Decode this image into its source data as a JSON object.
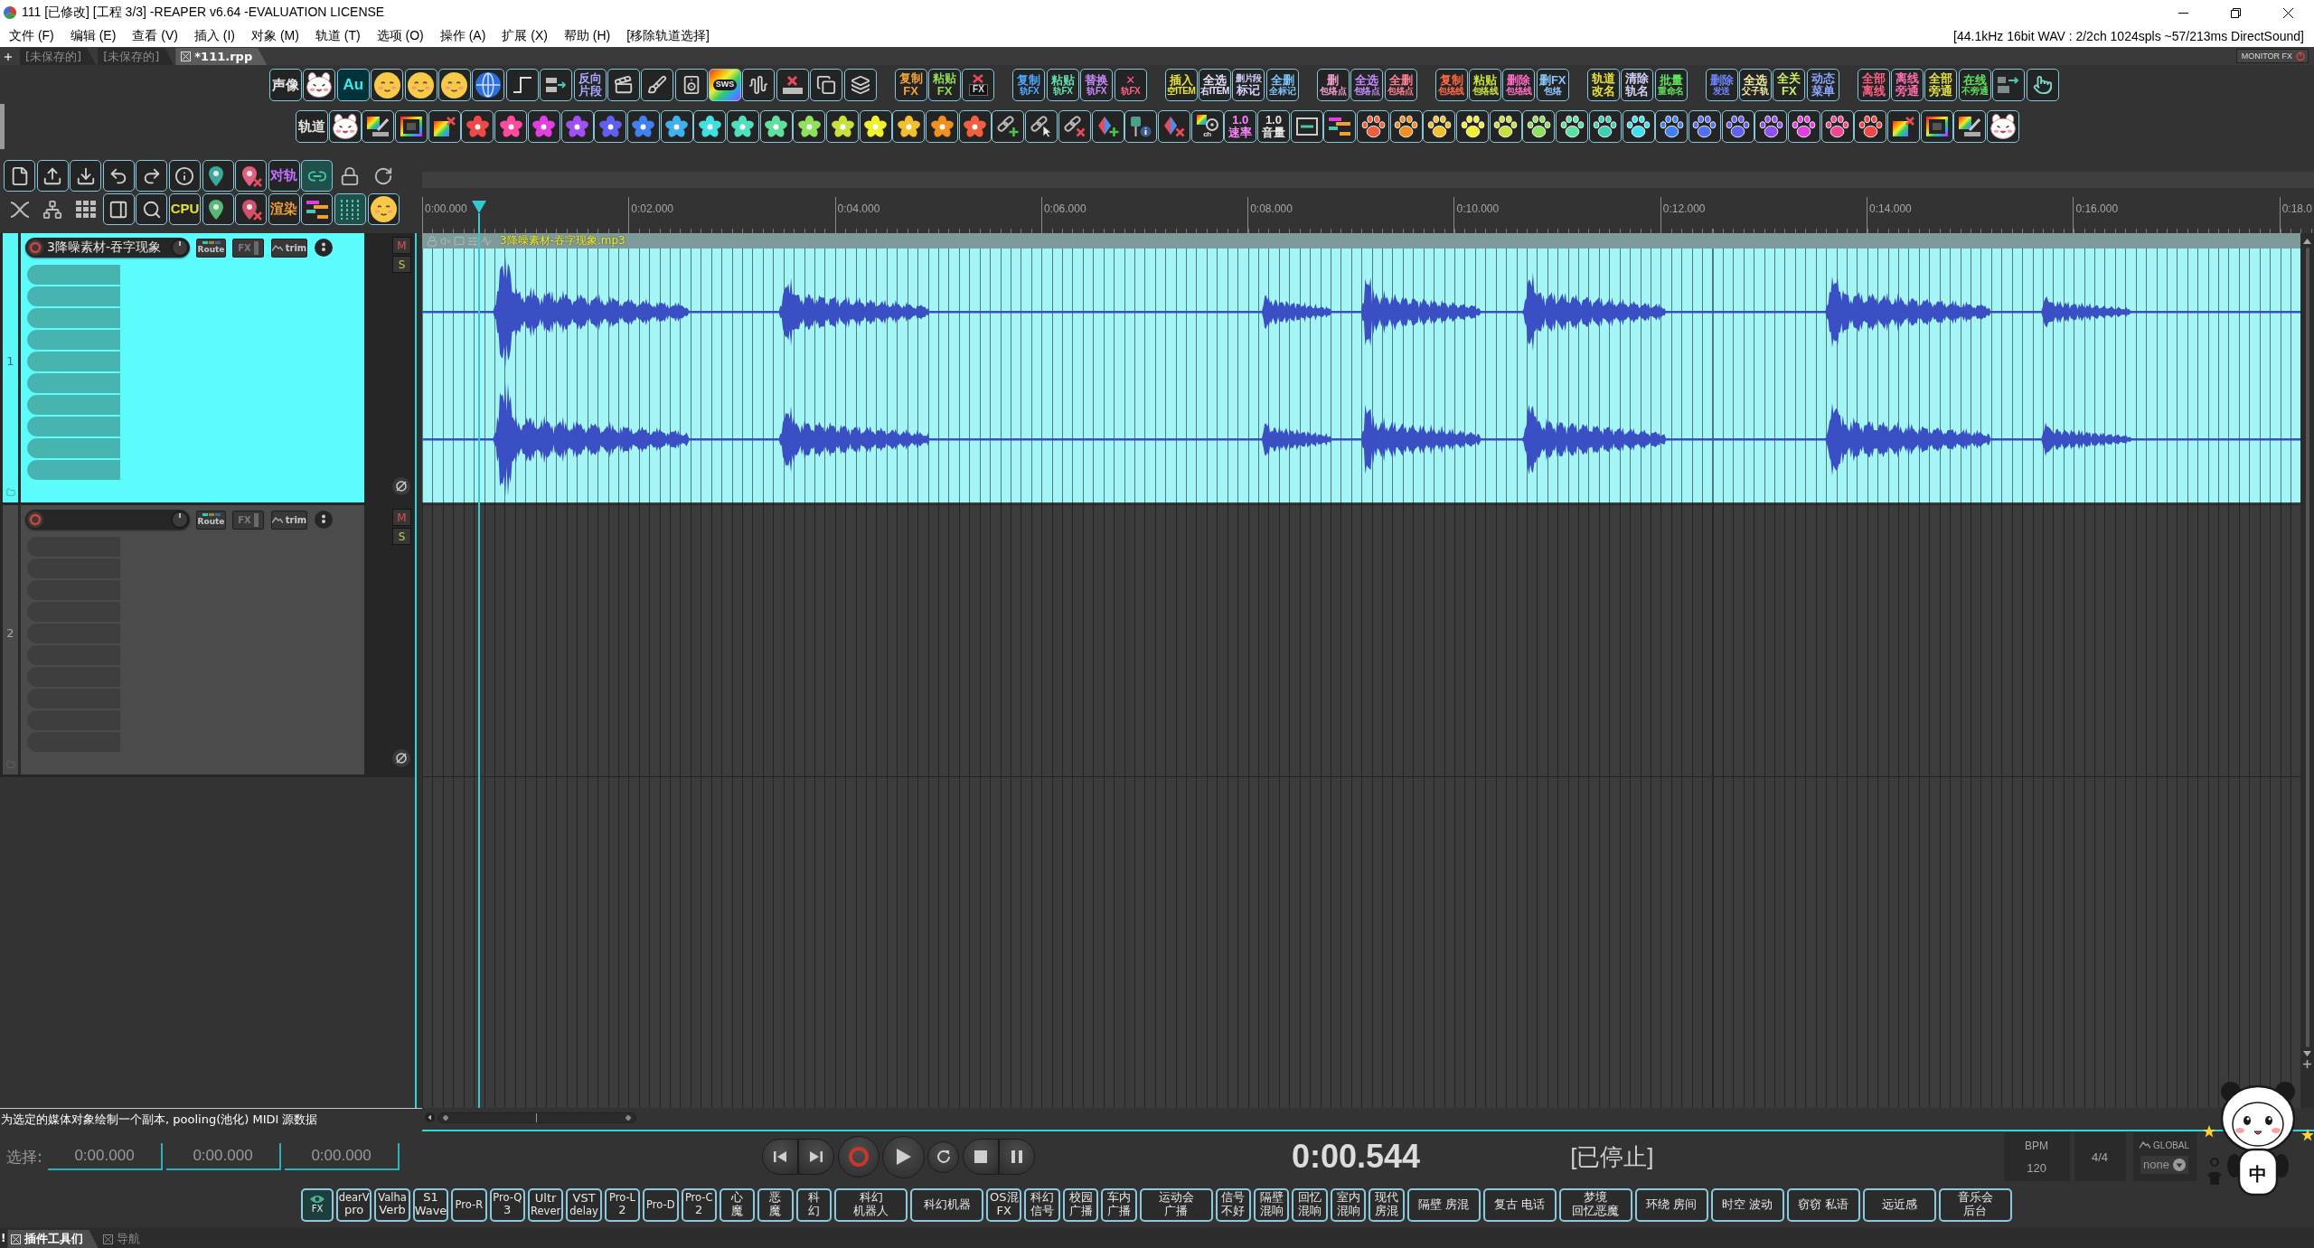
{
  "window": {
    "title": "111 [已修改] [工程 3/3] -REAPER v6.64 -EVALUATION LICENSE"
  },
  "menu": [
    "文件 (F)",
    "编辑 (E)",
    "查看 (V)",
    "插入 (I)",
    "对象 (M)",
    "轨道 (T)",
    "选项 (O)",
    "操作 (A)",
    "扩展 (X)",
    "帮助 (H)",
    "[移除轨道选择]"
  ],
  "audio_info": "[44.1kHz 16bit WAV : 2/2ch 1024spls ~57/213ms DirectSound]",
  "project_tabs": [
    {
      "label": "[未保存的]",
      "selected": false
    },
    {
      "label": "[未保存的]",
      "selected": false
    },
    {
      "label": "*111.rpp",
      "selected": true
    }
  ],
  "monitor_fx": {
    "label": "MONITOR FX"
  },
  "main_toolbar": [
    {
      "groups": [
        [
          {
            "kind": "text",
            "lines": [
              "声像"
            ]
          },
          {
            "kind": "mascot"
          },
          {
            "kind": "logo",
            "lines": [
              "Au"
            ]
          },
          {
            "kind": "emoji"
          },
          {
            "kind": "emoji"
          },
          {
            "kind": "emoji"
          },
          {
            "kind": "globe"
          },
          {
            "kind": "step"
          },
          {
            "kind": "lanes"
          },
          {
            "kind": "text",
            "lines": [
              "反向",
              "片段"
            ],
            "color": "#a9a9ff"
          },
          {
            "kind": "clapper"
          },
          {
            "kind": "brush"
          },
          {
            "kind": "speaker"
          },
          {
            "kind": "sws",
            "lines": [
              "SWS"
            ]
          },
          {
            "kind": "wave"
          },
          {
            "kind": "erase"
          },
          {
            "kind": "stack"
          },
          {
            "kind": "pages"
          }
        ],
        [
          {
            "kind": "text",
            "lines": [
              "复制",
              "FX"
            ],
            "color": "#f0a43a"
          },
          {
            "kind": "text",
            "lines": [
              "粘贴",
              "FX"
            ],
            "color": "#8fdc5a"
          },
          {
            "kind": "fxoff",
            "lines": [
              "FX"
            ]
          }
        ],
        [
          {
            "kind": "caption",
            "lines": [
              "复制",
              "轨FX"
            ],
            "color": "#4fa8ff"
          },
          {
            "kind": "caption",
            "lines": [
              "粘贴",
              "轨FX"
            ],
            "color": "#5fe0b0"
          },
          {
            "kind": "caption",
            "lines": [
              "替换",
              "轨FX"
            ],
            "color": "#c58bff"
          },
          {
            "kind": "caption",
            "lines": [
              "✕",
              "轨FX"
            ],
            "color": "#ff5f86"
          }
        ],
        [
          {
            "kind": "caption",
            "lines": [
              "插入",
              "空ITEM"
            ],
            "color": "#e6e23c"
          },
          {
            "kind": "caption",
            "lines": [
              "全选",
              "右ITEM"
            ],
            "color": "#e4e4ff"
          },
          {
            "kind": "text",
            "lines": [
              "删片段",
              "标记"
            ],
            "color": "#cfd0ff"
          },
          {
            "kind": "caption",
            "lines": [
              "全删",
              "全标记"
            ],
            "color": "#7cc4ff"
          }
        ],
        [
          {
            "kind": "caption",
            "lines": [
              "删",
              "包络点"
            ],
            "color": "#f0a0cc"
          },
          {
            "kind": "caption",
            "lines": [
              "全选",
              "包络点"
            ],
            "color": "#c28cff"
          },
          {
            "kind": "caption",
            "lines": [
              "全删",
              "包络点"
            ],
            "color": "#ff7f95"
          }
        ],
        [
          {
            "kind": "caption",
            "lines": [
              "复制",
              "包络线"
            ],
            "color": "#ff6a45"
          },
          {
            "kind": "caption",
            "lines": [
              "粘贴",
              "包络线"
            ],
            "color": "#c6e23c"
          },
          {
            "kind": "caption",
            "lines": [
              "删除",
              "包络线"
            ],
            "color": "#ff6ec4"
          },
          {
            "kind": "caption",
            "lines": [
              "删FX",
              "包络"
            ],
            "color": "#8cc8ff"
          }
        ],
        [
          {
            "kind": "text",
            "lines": [
              "轨道",
              "改名"
            ],
            "color": "#e6e23c"
          },
          {
            "kind": "text",
            "lines": [
              "清除",
              "轨名"
            ],
            "color": "#d4d4ff"
          },
          {
            "kind": "caption",
            "lines": [
              "批量",
              "重命名"
            ],
            "color": "#5fe05f"
          }
        ],
        [
          {
            "kind": "caption",
            "lines": [
              "删除",
              "发送"
            ],
            "color": "#6f86ff"
          },
          {
            "kind": "caption",
            "lines": [
              "全选",
              "父子轨"
            ],
            "color": "#f2f0a8"
          },
          {
            "kind": "text",
            "lines": [
              "全关",
              "FX"
            ],
            "color": "#c8f064"
          },
          {
            "kind": "text",
            "lines": [
              "动态",
              "菜单"
            ],
            "color": "#8aa6ff"
          }
        ],
        [
          {
            "kind": "text",
            "lines": [
              "全部",
              "离线"
            ],
            "color": "#ff5f86"
          },
          {
            "kind": "text",
            "lines": [
              "离线",
              "旁通"
            ],
            "color": "#ff6fb0"
          },
          {
            "kind": "text",
            "lines": [
              "全部",
              "旁通"
            ],
            "color": "#e6e23c"
          },
          {
            "kind": "caption",
            "lines": [
              "在线",
              "不旁通"
            ],
            "color": "#5fe05f"
          },
          {
            "kind": "move"
          },
          {
            "kind": "hand"
          }
        ]
      ]
    },
    {
      "groups": [
        [
          {
            "kind": "text",
            "lines": [
              "轨道"
            ]
          },
          {
            "kind": "mascot"
          },
          {
            "kind": "gradbrush"
          },
          {
            "kind": "gradframe"
          },
          {
            "kind": "gradx"
          },
          {
            "kind": "flower",
            "color": "#f04848"
          },
          {
            "kind": "flower",
            "color": "#ff4aa0"
          },
          {
            "kind": "flower",
            "color": "#e040e0"
          },
          {
            "kind": "flower",
            "color": "#a050f0"
          },
          {
            "kind": "flower",
            "color": "#6060f0"
          },
          {
            "kind": "flower",
            "color": "#4080f0"
          },
          {
            "kind": "flower",
            "color": "#40b0f0"
          },
          {
            "kind": "flower",
            "color": "#40e0e0"
          },
          {
            "kind": "flower",
            "color": "#50e0c0"
          },
          {
            "kind": "flower",
            "color": "#60e0a0"
          },
          {
            "kind": "flower",
            "color": "#90e060"
          },
          {
            "kind": "flower",
            "color": "#c8e040"
          },
          {
            "kind": "flower",
            "color": "#f0f030"
          },
          {
            "kind": "flower",
            "color": "#f0c030"
          },
          {
            "kind": "flower",
            "color": "#f09020"
          },
          {
            "kind": "flower",
            "color": "#f06040"
          },
          {
            "kind": "chainadd"
          },
          {
            "kind": "chainhand"
          },
          {
            "kind": "chainx"
          },
          {
            "kind": "diamondadd"
          },
          {
            "kind": "pininfo"
          },
          {
            "kind": "diamondx"
          },
          {
            "kind": "film",
            "lines": [
              "ch"
            ]
          },
          {
            "kind": "text",
            "lines": [
              "1.0",
              "速率"
            ],
            "color": "#ff85ff"
          },
          {
            "kind": "text",
            "lines": [
              "1.0",
              "音量"
            ]
          },
          {
            "kind": "insert"
          },
          {
            "kind": "bars"
          },
          {
            "kind": "paw",
            "color": "#f06040"
          },
          {
            "kind": "paw",
            "color": "#f09020"
          },
          {
            "kind": "paw",
            "color": "#f0c030"
          },
          {
            "kind": "paw",
            "color": "#f0f030"
          },
          {
            "kind": "paw",
            "color": "#c8e040"
          },
          {
            "kind": "paw",
            "color": "#90e060"
          },
          {
            "kind": "paw",
            "color": "#60e0a0"
          },
          {
            "kind": "paw",
            "color": "#40d0b0"
          },
          {
            "kind": "paw",
            "color": "#40e0f0"
          },
          {
            "kind": "paw",
            "color": "#4080f0"
          },
          {
            "kind": "paw",
            "color": "#5070f0"
          },
          {
            "kind": "paw",
            "color": "#6060f0"
          },
          {
            "kind": "paw",
            "color": "#9050f0"
          },
          {
            "kind": "paw",
            "color": "#e040e0"
          },
          {
            "kind": "paw",
            "color": "#f04890"
          },
          {
            "kind": "paw",
            "color": "#f04848"
          },
          {
            "kind": "gradx"
          },
          {
            "kind": "gradframe"
          },
          {
            "kind": "gradbrush"
          },
          {
            "kind": "mascot"
          }
        ]
      ]
    }
  ],
  "left_toolbar": [
    [
      {
        "kind": "newfile",
        "on": false
      },
      {
        "kind": "open",
        "on": false
      },
      {
        "kind": "save",
        "on": false
      },
      {
        "kind": "undo",
        "on": false
      },
      {
        "kind": "redo",
        "on": false
      },
      {
        "kind": "info",
        "on": false
      },
      {
        "kind": "marker",
        "on": false
      },
      {
        "kind": "markerx",
        "on": false
      },
      {
        "kind": "text",
        "lines": [
          "对轨"
        ],
        "color": "#c070ff",
        "on": false
      },
      {
        "kind": "link",
        "on": true
      },
      {
        "kind": "lock",
        "on": false
      },
      {
        "kind": "loop",
        "on": false
      }
    ],
    [
      {
        "kind": "crossfade",
        "on": false
      },
      {
        "kind": "tree",
        "on": false
      },
      {
        "kind": "grid",
        "on": false
      },
      {
        "kind": "panel",
        "on": false
      },
      {
        "kind": "zoom",
        "on": false
      },
      {
        "kind": "text",
        "lines": [
          "CPU"
        ],
        "color": "#e0e040",
        "on": false
      },
      {
        "kind": "pin",
        "on": false
      },
      {
        "kind": "pinx",
        "on": false
      },
      {
        "kind": "text",
        "lines": [
          "渲染"
        ],
        "color": "#f0a030",
        "on": false
      },
      {
        "kind": "bars",
        "on": false
      },
      {
        "kind": "gridlines",
        "on": true
      },
      {
        "kind": "emoji",
        "on": false
      }
    ]
  ],
  "ruler": [
    "0:00.000",
    "0:02.000",
    "0:04.000",
    "0:06.000",
    "0:08.000",
    "0:10.000",
    "0:12.000",
    "0:14.000",
    "0:16.000",
    "0:18.0"
  ],
  "tracks": [
    {
      "number": "1",
      "name": "3降噪素材-吞字现象",
      "selected": true,
      "route": "Route",
      "fx": "FX",
      "trim": "trim",
      "mute": "M",
      "solo": "S",
      "items": [
        {
          "name": "3降噪素材-吞字现象.mp3"
        }
      ]
    },
    {
      "number": "2",
      "selected": false,
      "route": "Route",
      "fx": "FX",
      "trim": "trim",
      "mute": "M",
      "solo": "S"
    }
  ],
  "status_text": "为选定的媒体对象绘制一个副本, pooling(池化) MIDI 源数据",
  "selection": {
    "label": "选择:",
    "fields": [
      "0:00.000",
      "0:00.000",
      "0:00.000"
    ]
  },
  "transport": [
    [
      {
        "kind": "start"
      },
      {
        "kind": "end"
      }
    ],
    [
      {
        "kind": "record"
      }
    ],
    [
      {
        "kind": "play"
      }
    ],
    [
      {
        "kind": "repeat"
      }
    ],
    [
      {
        "kind": "stop"
      },
      {
        "kind": "pause"
      }
    ]
  ],
  "time": "0:00.544",
  "play_state": "[已停止]",
  "tempo": {
    "label": "BPM",
    "value": "120"
  },
  "time_signature": "4/4",
  "automation": {
    "label": "GLOBAL",
    "value": "none"
  },
  "fx_toolbar": [
    {
      "kind": "eye",
      "lines": [
        "FX"
      ]
    },
    {
      "kind": "narrow",
      "lines": [
        "dearV",
        "pro"
      ]
    },
    {
      "kind": "narrow",
      "lines": [
        "Valha",
        "Verb"
      ]
    },
    {
      "kind": "narrow",
      "lines": [
        "S1",
        "Wave"
      ]
    },
    {
      "kind": "narrow",
      "lines": [
        "Pro-R"
      ]
    },
    {
      "kind": "narrow",
      "lines": [
        "Pro-Q",
        "3"
      ]
    },
    {
      "kind": "narrow",
      "lines": [
        "Ultr",
        "Rever"
      ]
    },
    {
      "kind": "narrow",
      "lines": [
        "VST",
        "delay"
      ]
    },
    {
      "kind": "narrow",
      "lines": [
        "Pro-L",
        "2"
      ]
    },
    {
      "kind": "narrow",
      "lines": [
        "Pro-D"
      ]
    },
    {
      "kind": "narrow",
      "lines": [
        "Pro-C",
        "2"
      ]
    },
    {
      "kind": "narrow",
      "lines": [
        "心",
        "魔"
      ]
    },
    {
      "kind": "narrow",
      "lines": [
        "恶",
        "魔"
      ]
    },
    {
      "kind": "narrow",
      "lines": [
        "科",
        "幻"
      ]
    },
    {
      "kind": "wide",
      "lines": [
        "科幻",
        "机器人"
      ]
    },
    {
      "kind": "wide",
      "lines": [
        "科幻机器"
      ]
    },
    {
      "kind": "narrow",
      "lines": [
        "OS混",
        "FX"
      ]
    },
    {
      "kind": "narrow",
      "lines": [
        "科幻",
        "信号"
      ]
    },
    {
      "kind": "narrow",
      "lines": [
        "校园",
        "广播"
      ]
    },
    {
      "kind": "narrow",
      "lines": [
        "车内",
        "广播"
      ]
    },
    {
      "kind": "wide",
      "lines": [
        "运动会",
        "广播"
      ]
    },
    {
      "kind": "narrow",
      "lines": [
        "信号",
        "不好"
      ]
    },
    {
      "kind": "narrow",
      "lines": [
        "隔壁",
        "混响"
      ]
    },
    {
      "kind": "narrow",
      "lines": [
        "回忆",
        "混响"
      ]
    },
    {
      "kind": "narrow",
      "lines": [
        "室内",
        "混响"
      ]
    },
    {
      "kind": "narrow",
      "lines": [
        "现代",
        "房混"
      ]
    },
    {
      "kind": "wide",
      "lines": [
        "隔壁 房混"
      ]
    },
    {
      "kind": "wide",
      "lines": [
        "复古 电话"
      ]
    },
    {
      "kind": "wide",
      "lines": [
        "梦境",
        "回忆恶魔"
      ]
    },
    {
      "kind": "wide",
      "lines": [
        "环绕 房间"
      ]
    },
    {
      "kind": "wide",
      "lines": [
        "时空 波动"
      ]
    },
    {
      "kind": "wide",
      "lines": [
        "窃窃 私语"
      ]
    },
    {
      "kind": "wide",
      "lines": [
        "远近感"
      ]
    },
    {
      "kind": "wide",
      "lines": [
        "音乐会",
        "后台"
      ]
    }
  ],
  "dock": {
    "mark": "!",
    "tabs": [
      {
        "label": "插件工具们",
        "selected": true
      },
      {
        "label": "导航",
        "selected": false
      }
    ]
  },
  "ime": {
    "label": "中"
  }
}
